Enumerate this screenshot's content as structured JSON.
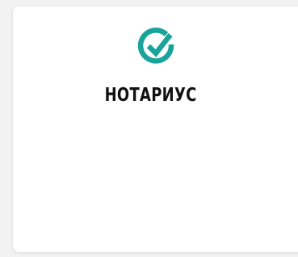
{
  "card": {
    "title": "НОТАРИУС",
    "logo_icon": "check-circle-icon",
    "accent_color": "#1aa39b"
  }
}
